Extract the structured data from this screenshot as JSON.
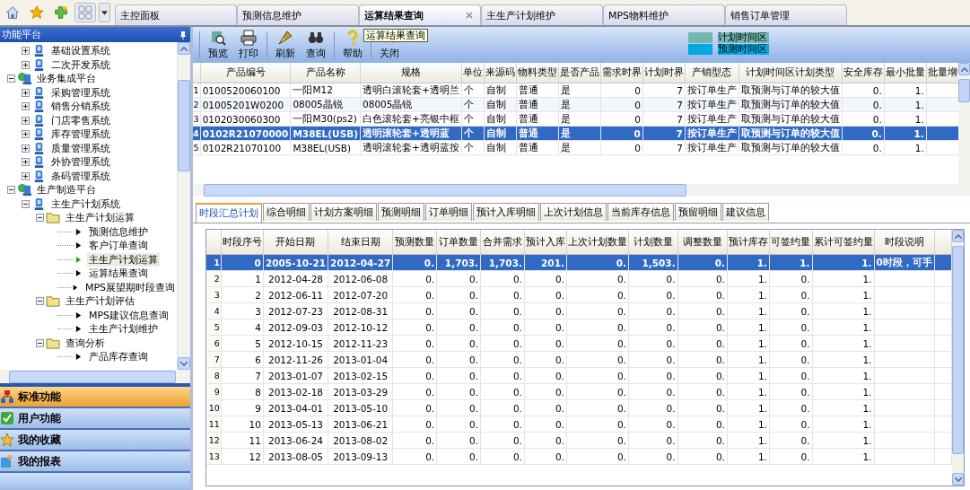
{
  "top_tabs": [
    {
      "label": "主控面板",
      "selected": false
    },
    {
      "label": "预测信息维护",
      "selected": false
    },
    {
      "label": "运算结果查询",
      "selected": true
    },
    {
      "label": "主生产计划维护",
      "selected": false
    },
    {
      "label": "MPS物料维护",
      "selected": false
    },
    {
      "label": "销售订单管理",
      "selected": false
    }
  ],
  "sidebar": {
    "title": "功能平台",
    "tree": [
      {
        "children": [
          {
            "label": "基础设置系统",
            "kind": "system",
            "expanded": false
          },
          {
            "label": "二次开发系统",
            "kind": "system",
            "expanded": false
          }
        ]
      },
      {
        "label": "业务集成平台",
        "kind": "platform",
        "expanded": true,
        "children": [
          {
            "label": "采购管理系统",
            "kind": "system",
            "expanded": false
          },
          {
            "label": "销售分销系统",
            "kind": "system",
            "expanded": false
          },
          {
            "label": "门店零售系统",
            "kind": "system",
            "expanded": false
          },
          {
            "label": "库存管理系统",
            "kind": "system",
            "expanded": false
          },
          {
            "label": "质量管理系统",
            "kind": "system",
            "expanded": false
          },
          {
            "label": "外协管理系统",
            "kind": "system",
            "expanded": false
          },
          {
            "label": "条码管理系统",
            "kind": "system",
            "expanded": false
          }
        ]
      },
      {
        "label": "生产制造平台",
        "kind": "platform",
        "expanded": true,
        "children": [
          {
            "label": "主生产计划系统",
            "kind": "system",
            "expanded": true,
            "children": [
              {
                "label": "主生产计划运算",
                "kind": "folder",
                "expanded": true,
                "children": [
                  {
                    "label": "预测信息维护",
                    "kind": "leaf",
                    "selected": false
                  },
                  {
                    "label": "客户订单查询",
                    "kind": "leaf",
                    "selected": false
                  },
                  {
                    "label": "主生产计划运算",
                    "kind": "leaf",
                    "selected": true
                  },
                  {
                    "label": "运算结果查询",
                    "kind": "leaf",
                    "selected": false
                  },
                  {
                    "label": "MPS展望期时段查询",
                    "kind": "leaf",
                    "selected": false
                  }
                ]
              },
              {
                "label": "主生产计划评估",
                "kind": "folder",
                "expanded": true,
                "children": [
                  {
                    "label": "MPS建议信息查询",
                    "kind": "leaf",
                    "selected": false
                  },
                  {
                    "label": "主生产计划维护",
                    "kind": "leaf",
                    "selected": false
                  }
                ]
              },
              {
                "label": "查询分析",
                "kind": "folder",
                "expanded": true,
                "children": [
                  {
                    "label": "产品库存查询",
                    "kind": "leaf",
                    "selected": false
                  }
                ]
              }
            ]
          }
        ]
      }
    ],
    "sections": [
      {
        "label": "标准功能",
        "selected": true,
        "kind": "standard"
      },
      {
        "label": "用户功能",
        "selected": false,
        "kind": "user"
      },
      {
        "label": "我的收藏",
        "selected": false,
        "kind": "favorites"
      },
      {
        "label": "我的报表",
        "selected": false,
        "kind": "reports"
      }
    ]
  },
  "toolbar": {
    "buttons": [
      {
        "label": "预览",
        "kind": "preview"
      },
      {
        "label": "打印",
        "kind": "print"
      },
      {
        "label": "刷新",
        "kind": "refresh"
      },
      {
        "label": "查询",
        "kind": "search"
      },
      {
        "label": "帮助",
        "kind": "help"
      },
      {
        "label": "关闭",
        "kind": "close"
      }
    ],
    "tooltip": "运算结果查询",
    "legend": [
      {
        "label": "计划时间区",
        "color": "#72b8b0"
      },
      {
        "label": "预测时间区",
        "color": "#00a9e0"
      }
    ]
  },
  "products": {
    "columns": [
      "产品编号",
      "产品名称",
      "规格",
      "单位",
      "来源码",
      "物料类型",
      "是否产品",
      "需求时界",
      "计划时界",
      "产销型态",
      "计划时间区计划类型",
      "安全库存",
      "最小批量",
      "批量增"
    ],
    "rows": [
      {
        "no": "1",
        "selected": false,
        "cells": [
          "0100520060100",
          "一阳M12",
          "透明白滚轮套+透明兰",
          "个",
          "自制",
          "普通",
          "是",
          "0",
          "7",
          "按订单生产",
          "取预测与订单的较大值",
          "0.",
          "1."
        ]
      },
      {
        "no": "2",
        "selected": false,
        "cells": [
          "01005201W0200",
          "08005晶锐",
          "08005晶锐",
          "个",
          "自制",
          "普通",
          "是",
          "0",
          "7",
          "按订单生产",
          "取预测与订单的较大值",
          "0.",
          "1."
        ]
      },
      {
        "no": "3",
        "selected": false,
        "cells": [
          "0102030060300",
          "一阳M30(ps2)",
          "白色滚轮套+亮银中框",
          "个",
          "自制",
          "普通",
          "是",
          "0",
          "7",
          "按订单生产",
          "取预测与订单的较大值",
          "0.",
          "1."
        ]
      },
      {
        "no": "4",
        "selected": true,
        "cells": [
          "0102R21070000",
          "M38EL(USB)",
          "透明滚轮套+透明蓝",
          "个",
          "自制",
          "普通",
          "是",
          "0",
          "7",
          "按订单生产",
          "取预测与订单的较大值",
          "0.",
          "1."
        ]
      },
      {
        "no": "5",
        "selected": false,
        "cells": [
          "0102R21070100",
          "M38EL(USB)",
          "透明滚轮套+透明蓝按",
          "个",
          "自制",
          "普通",
          "是",
          "0",
          "7",
          "按订单生产",
          "取预测与订单的较大值",
          "0.",
          "1."
        ]
      }
    ]
  },
  "detail_tabs": [
    {
      "label": "时段汇总计划",
      "selected": true
    },
    {
      "label": "综合明细",
      "selected": false
    },
    {
      "label": "计划方案明细",
      "selected": false
    },
    {
      "label": "预测明细",
      "selected": false
    },
    {
      "label": "订单明细",
      "selected": false
    },
    {
      "label": "预计入库明细",
      "selected": false
    },
    {
      "label": "上次计划信息",
      "selected": false
    },
    {
      "label": "当前库存信息",
      "selected": false
    },
    {
      "label": "预留明细",
      "selected": false
    },
    {
      "label": "建议信息",
      "selected": false
    }
  ],
  "periods": {
    "columns": [
      "时段序号",
      "开始日期",
      "结束日期",
      "预测数量",
      "订单数量",
      "合并需求",
      "预计入库",
      "上次计划数量",
      "计划数量",
      "调整数量",
      "预计库存",
      "可签约量",
      "累计可签约量",
      "时段说明"
    ],
    "rows": [
      {
        "no": "1",
        "selected": true,
        "cells": [
          "0",
          "2005-10-21",
          "2012-04-27",
          "0.",
          "1,703.",
          "1,703.",
          "201.",
          "0.",
          "1,503.",
          "0.",
          "1.",
          "1.",
          "1.",
          "0时段，可手"
        ]
      },
      {
        "no": "2",
        "selected": false,
        "cells": [
          "1",
          "2012-04-28",
          "2012-06-08",
          "0.",
          "0.",
          "0.",
          "0.",
          "0.",
          "0.",
          "0.",
          "1.",
          "0.",
          "1."
        ]
      },
      {
        "no": "3",
        "selected": false,
        "cells": [
          "2",
          "2012-06-11",
          "2012-07-20",
          "0.",
          "0.",
          "0.",
          "0.",
          "0.",
          "0.",
          "0.",
          "1.",
          "0.",
          "1."
        ]
      },
      {
        "no": "4",
        "selected": false,
        "cells": [
          "3",
          "2012-07-23",
          "2012-08-31",
          "0.",
          "0.",
          "0.",
          "0.",
          "0.",
          "0.",
          "0.",
          "1.",
          "0.",
          "1."
        ]
      },
      {
        "no": "5",
        "selected": false,
        "cells": [
          "4",
          "2012-09-03",
          "2012-10-12",
          "0.",
          "0.",
          "0.",
          "0.",
          "0.",
          "0.",
          "0.",
          "1.",
          "0.",
          "1."
        ]
      },
      {
        "no": "6",
        "selected": false,
        "cells": [
          "5",
          "2012-10-15",
          "2012-11-23",
          "0.",
          "0.",
          "0.",
          "0.",
          "0.",
          "0.",
          "0.",
          "1.",
          "0.",
          "1."
        ]
      },
      {
        "no": "7",
        "selected": false,
        "cells": [
          "6",
          "2012-11-26",
          "2013-01-04",
          "0.",
          "0.",
          "0.",
          "0.",
          "0.",
          "0.",
          "0.",
          "1.",
          "0.",
          "1."
        ]
      },
      {
        "no": "8",
        "selected": false,
        "cells": [
          "7",
          "2013-01-07",
          "2013-02-15",
          "0.",
          "0.",
          "0.",
          "0.",
          "0.",
          "0.",
          "0.",
          "1.",
          "0.",
          "1."
        ]
      },
      {
        "no": "9",
        "selected": false,
        "cells": [
          "8",
          "2013-02-18",
          "2013-03-29",
          "0.",
          "0.",
          "0.",
          "0.",
          "0.",
          "0.",
          "0.",
          "1.",
          "0.",
          "1."
        ]
      },
      {
        "no": "10",
        "selected": false,
        "cells": [
          "9",
          "2013-04-01",
          "2013-05-10",
          "0.",
          "0.",
          "0.",
          "0.",
          "0.",
          "0.",
          "0.",
          "1.",
          "0.",
          "1."
        ]
      },
      {
        "no": "11",
        "selected": false,
        "cells": [
          "10",
          "2013-05-13",
          "2013-06-21",
          "0.",
          "0.",
          "0.",
          "0.",
          "0.",
          "0.",
          "0.",
          "1.",
          "0.",
          "1."
        ]
      },
      {
        "no": "12",
        "selected": false,
        "cells": [
          "11",
          "2013-06-24",
          "2013-08-02",
          "0.",
          "0.",
          "0.",
          "0.",
          "0.",
          "0.",
          "0.",
          "1.",
          "0.",
          "1."
        ]
      },
      {
        "no": "13",
        "selected": false,
        "cells": [
          "12",
          "2013-08-05",
          "2013-09-13",
          "0.",
          "0.",
          "0.",
          "0.",
          "0.",
          "0.",
          "0.",
          "1.",
          "0.",
          "1."
        ]
      }
    ]
  }
}
